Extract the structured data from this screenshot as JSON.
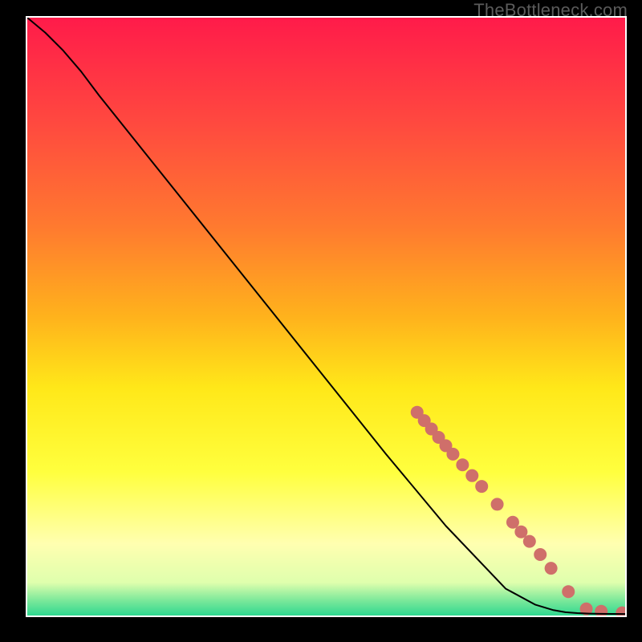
{
  "watermark": "TheBottleneck.com",
  "chart_data": {
    "type": "line",
    "title": "",
    "xlabel": "",
    "ylabel": "",
    "xlim": [
      0,
      100
    ],
    "ylim": [
      0,
      100
    ],
    "grid": false,
    "legend": false,
    "gradient_stops": [
      {
        "pos": 0.0,
        "color": "#ff1b4a"
      },
      {
        "pos": 0.18,
        "color": "#ff4a3f"
      },
      {
        "pos": 0.35,
        "color": "#ff7a2f"
      },
      {
        "pos": 0.5,
        "color": "#ffb21c"
      },
      {
        "pos": 0.62,
        "color": "#ffe819"
      },
      {
        "pos": 0.76,
        "color": "#ffff3e"
      },
      {
        "pos": 0.88,
        "color": "#ffffb0"
      },
      {
        "pos": 0.945,
        "color": "#dfffad"
      },
      {
        "pos": 0.975,
        "color": "#7be89a"
      },
      {
        "pos": 1.0,
        "color": "#2fd890"
      }
    ],
    "series": [
      {
        "name": "curve",
        "stroke": "#000000",
        "x": [
          0.0,
          3.0,
          6.0,
          9.0,
          12.0,
          16.0,
          20.0,
          30.0,
          40.0,
          50.0,
          60.0,
          70.0,
          80.0,
          85.0,
          88.0,
          90.0,
          92.0,
          94.0,
          96.0,
          98.0,
          100.0
        ],
        "y": [
          100.0,
          97.5,
          94.5,
          91.0,
          87.0,
          82.0,
          77.0,
          64.5,
          52.0,
          39.5,
          27.0,
          15.0,
          4.5,
          1.8,
          0.9,
          0.55,
          0.4,
          0.32,
          0.28,
          0.26,
          0.25
        ]
      }
    ],
    "marker_series": {
      "name": "dense-dots",
      "color": "#cf6f6a",
      "radius": 8,
      "x": [
        65.2,
        66.4,
        67.6,
        68.8,
        70.0,
        71.2,
        72.8,
        74.4,
        76.0,
        78.6,
        81.2,
        82.6,
        84.0,
        85.8,
        87.6,
        90.5,
        93.5,
        96.0,
        99.5
      ],
      "y": [
        34.0,
        32.6,
        31.2,
        29.8,
        28.4,
        27.0,
        25.2,
        23.4,
        21.6,
        18.6,
        15.6,
        14.0,
        12.4,
        10.2,
        7.9,
        4.0,
        1.1,
        0.7,
        0.45
      ]
    }
  }
}
